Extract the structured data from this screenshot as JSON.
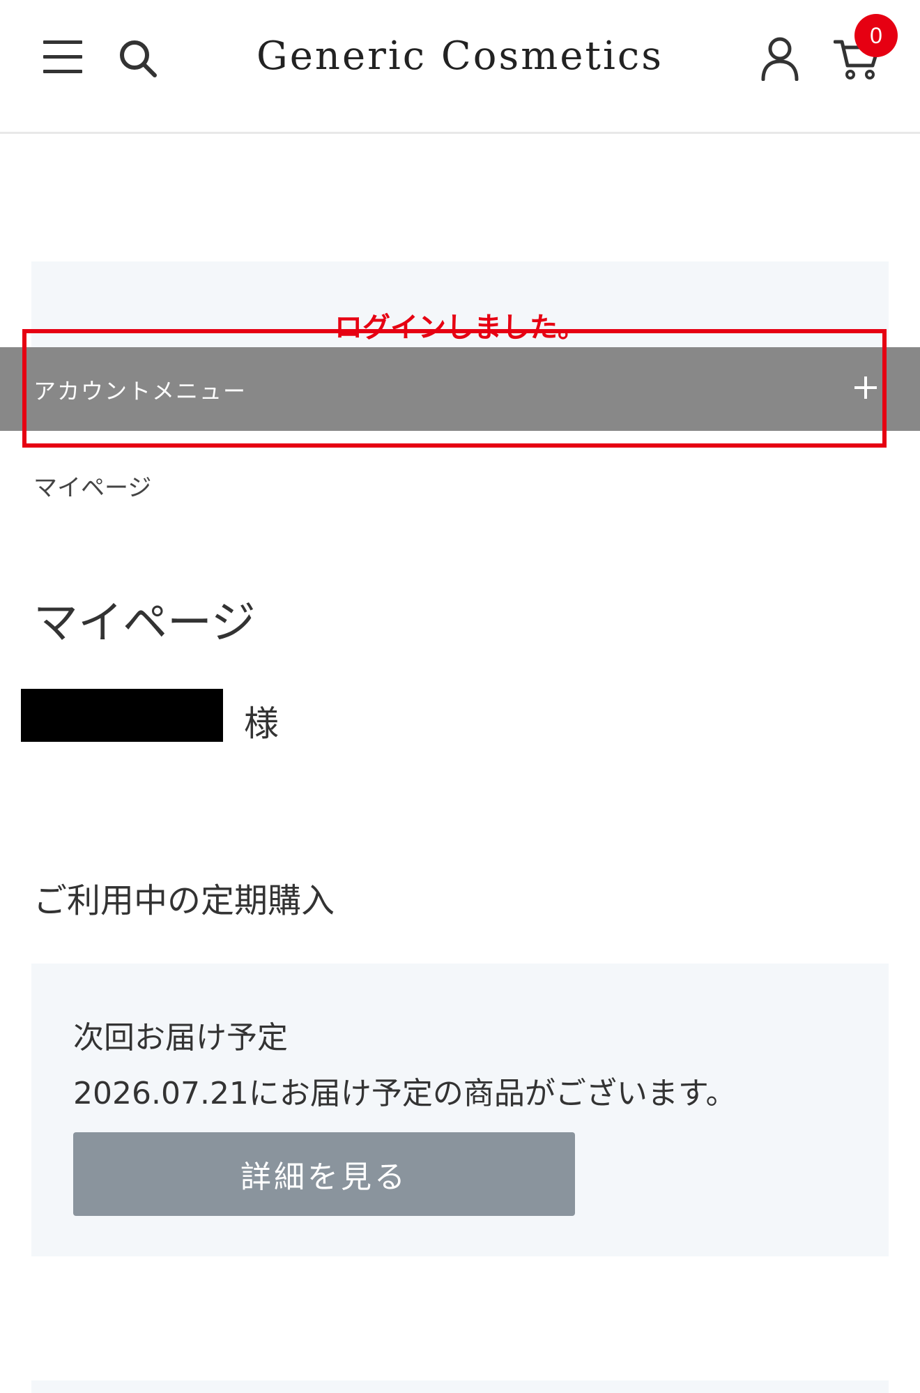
{
  "header": {
    "brand": "Generic Cosmetics",
    "cart_count": "0",
    "icons": [
      "hamburger-menu-icon",
      "search-icon",
      "user-icon",
      "cart-icon"
    ]
  },
  "login": {
    "message": "ログインしました。"
  },
  "account_menu": {
    "label": "アカウントメニュー",
    "toggle": "+"
  },
  "breadcrumb": {
    "current": "マイページ"
  },
  "page": {
    "title": "マイページ",
    "honorific": "様"
  },
  "subscription": {
    "section_title": "ご利用中の定期購入",
    "heading": "次回お届け予定",
    "text": "2026.07.21にお届け予定の商品がございます。",
    "button_label": "詳細を見る"
  },
  "colors": {
    "accent_red": "#e60012",
    "account_bar": "#888888",
    "card_background": "#f4f7fa",
    "button_gray": "#8a949d"
  }
}
